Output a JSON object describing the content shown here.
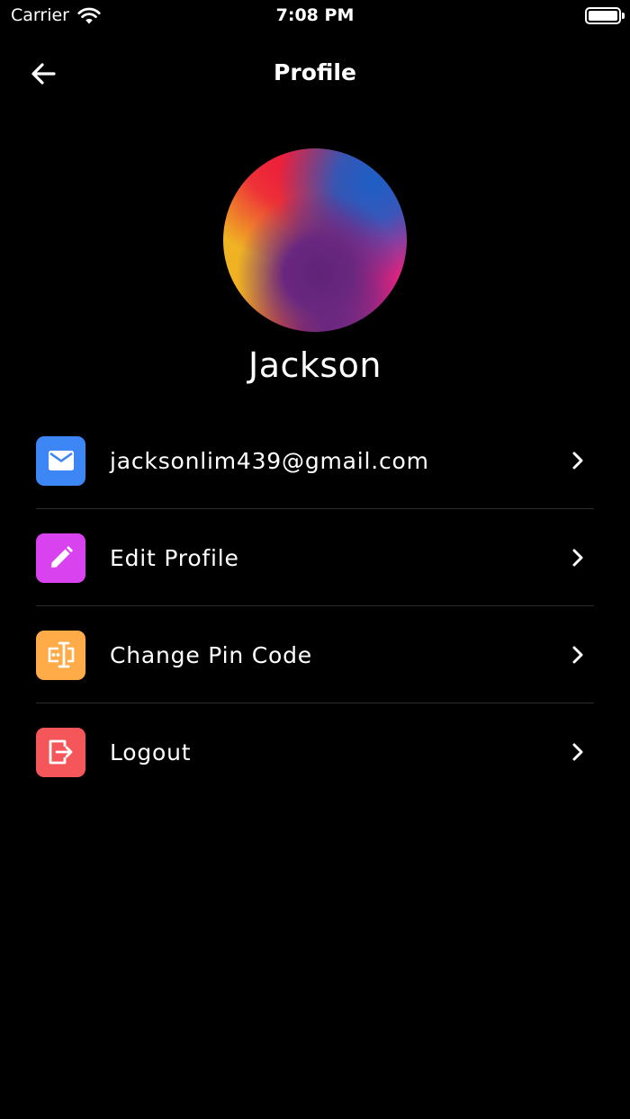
{
  "status_bar": {
    "carrier": "Carrier",
    "time": "7:08 PM"
  },
  "nav": {
    "title": "Profile",
    "back_icon": "arrow-left-icon"
  },
  "profile": {
    "name": "Jackson"
  },
  "menu": {
    "items": [
      {
        "label": "jacksonlim439@gmail.com",
        "icon": "mail-icon",
        "color": "#3d86f5"
      },
      {
        "label": "Edit Profile",
        "icon": "pencil-icon",
        "color": "#d843ef"
      },
      {
        "label": "Change Pin Code",
        "icon": "pin-code-icon",
        "color": "#ffab47"
      },
      {
        "label": "Logout",
        "icon": "logout-icon",
        "color": "#f5565a"
      }
    ]
  },
  "colors": {
    "background": "#000000",
    "text": "#ffffff",
    "divider": "#2b2b2b"
  }
}
